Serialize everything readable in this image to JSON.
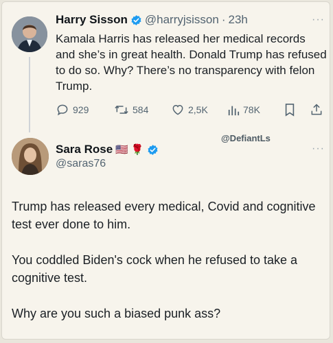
{
  "tweet1": {
    "name": "Harry Sisson",
    "handle": "@harryjsisson",
    "time": "23h",
    "more": "···",
    "text": "Kamala Harris has released her medical records and she’s in great health. Donald Trump has refused to do so. Why? There’s no transparency with felon Trump.",
    "replies": "929",
    "reposts": "584",
    "likes": "2,5K",
    "views": "78K"
  },
  "watermark": "@DefiantLs",
  "tweet2": {
    "name": "Sara Rose",
    "flag_emoji": "🇺🇸",
    "rose_emoji": "🌹",
    "handle": "@saras76",
    "more": "···",
    "paragraphs": [
      "Trump has released every medical, Covid and cognitive test ever done to him.",
      "You coddled Biden's cock when he refused to take a cognitive test.",
      "Why are you such a biased punk ass?"
    ]
  },
  "colors": {
    "verified": "#1d9bf0",
    "secondary_text": "#536471",
    "card_bg": "#f7f4ec"
  }
}
